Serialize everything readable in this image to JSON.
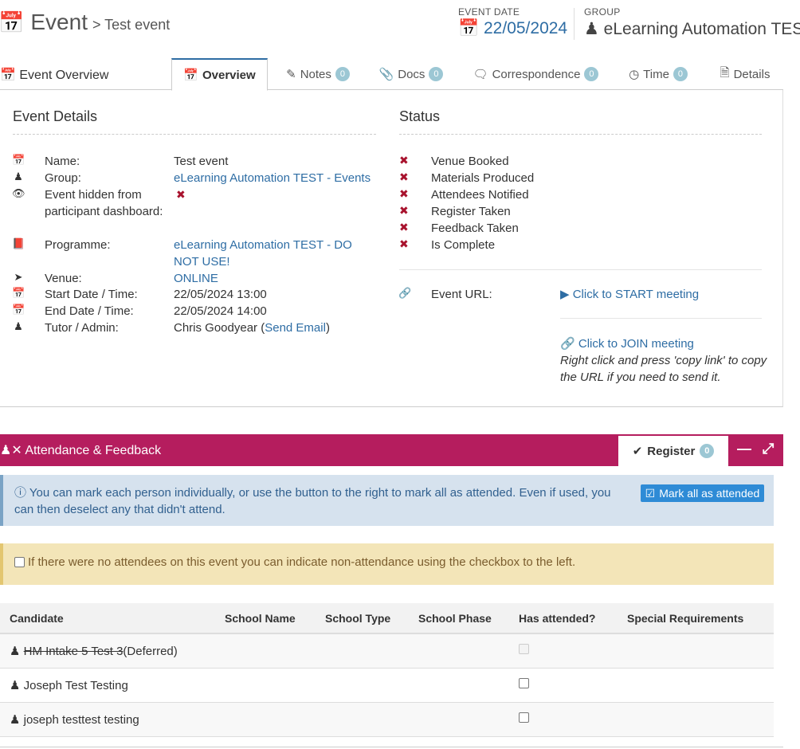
{
  "header": {
    "title": "Event",
    "subtitle": "> Test event",
    "event_date_label": "EVENT DATE",
    "event_date": "22/05/2024",
    "group_label": "GROUP",
    "group": "eLearning Automation TES"
  },
  "tabs": {
    "title": "Event Overview",
    "items": [
      {
        "label": "Overview",
        "icon": "calendar-icon",
        "active": true
      },
      {
        "label": "Notes",
        "icon": "pencil-icon",
        "count": "0"
      },
      {
        "label": "Docs",
        "icon": "paperclip-icon",
        "count": "0"
      },
      {
        "label": "Correspondence",
        "icon": "comments-icon",
        "count": "0"
      },
      {
        "label": "Time",
        "icon": "clock-icon",
        "count": "0"
      },
      {
        "label": "Details",
        "icon": "file-icon"
      }
    ]
  },
  "event_details": {
    "heading": "Event Details",
    "rows": [
      {
        "icon": "calendar-icon",
        "label": "Name:",
        "value": "Test event"
      },
      {
        "icon": "user-icon",
        "label": "Group:",
        "value": "eLearning Automation TEST - Events"
      },
      {
        "icon": "eye-icon",
        "label": "Event hidden from participant dashboard:",
        "value": "✖"
      },
      {
        "icon": "book-icon",
        "label": "Programme:",
        "value": "eLearning Automation TEST - DO NOT USE!"
      },
      {
        "icon": "location-arrow-icon",
        "label": "Venue:",
        "value": "ONLINE"
      },
      {
        "icon": "calendar-icon",
        "label": "Start Date / Time:",
        "value": "22/05/2024 13:00"
      },
      {
        "icon": "calendar-icon",
        "label": "End Date / Time:",
        "value": "22/05/2024 14:00"
      },
      {
        "icon": "user-icon",
        "label": "Tutor / Admin:",
        "value": "Chris Goodyear",
        "link": "Send Email"
      }
    ]
  },
  "status": {
    "heading": "Status",
    "items": [
      "Venue Booked",
      "Materials Produced",
      "Attendees Notified",
      "Register Taken",
      "Feedback Taken",
      "Is Complete"
    ],
    "event_url_label": "Event URL:",
    "start_meeting": "Click to START meeting",
    "join_meeting": "Click to JOIN meeting",
    "join_note": "Right click and press 'copy link' to copy the URL if you need to send it."
  },
  "attendance": {
    "title": "Attendance & Feedback",
    "register_label": "Register",
    "register_count": "0",
    "info_text": "You can mark each person individually, or use the button to the right to mark all as attended. Even if used, you can then deselect any that didn't attend.",
    "mark_all_label": "Mark all as attended",
    "no_attendees_text": "If there were no attendees on this event you can indicate non-attendance using the checkbox to the left.",
    "columns": [
      "Candidate",
      "School Name",
      "School Type",
      "School Phase",
      "Has attended?",
      "Special Requirements"
    ],
    "rows": [
      {
        "name": "HM Intake 5 Test 3",
        "suffix": "(Deferred)",
        "deferred": true
      },
      {
        "name": "Joseph Test Testing",
        "suffix": "",
        "deferred": false
      },
      {
        "name": "joseph testtest testing",
        "suffix": "",
        "deferred": false
      }
    ]
  },
  "colors": {
    "accent": "#b51d5e",
    "link": "#2e6da4",
    "status_red": "#a8122d",
    "badge": "#9cc7d4"
  }
}
